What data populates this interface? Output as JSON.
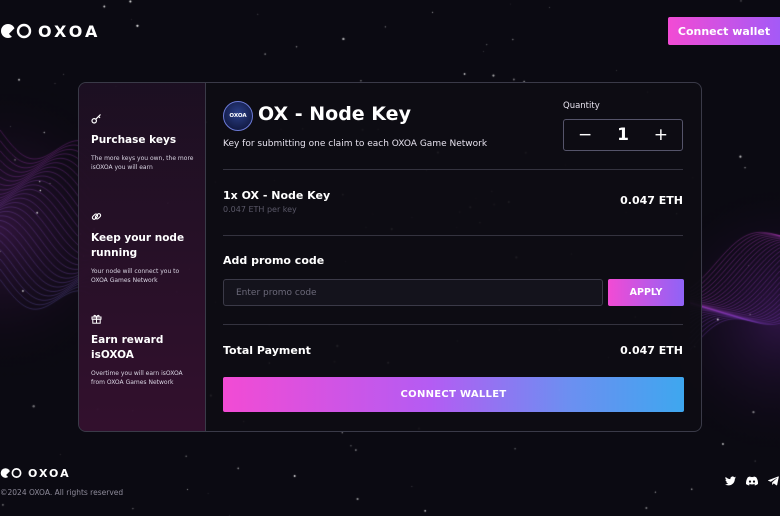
{
  "header": {
    "brand": "OXOA",
    "connect_label": "Connect wallet"
  },
  "features": [
    {
      "icon": "key-icon",
      "title": "Purchase keys",
      "text": "The more keys you own, the more isOXOA you will earn"
    },
    {
      "icon": "link-icon",
      "title": "Keep your node running",
      "text": "Your node will connect you to OXOA Games Network"
    },
    {
      "icon": "gift-icon",
      "title": "Earn reward isOXOA",
      "text": "Overtime you will earn isOXOA from OXOA Games Network"
    }
  ],
  "product": {
    "avatar_text": "OXOA",
    "title": "OX - Node Key",
    "subtitle": "Key for submitting one claim to each OXOA Game Network",
    "quantity_label": "Quantity",
    "quantity": "1",
    "minus": "−",
    "plus": "+"
  },
  "line_item": {
    "name": "1x OX - Node Key",
    "per_key": "0.047 ETH per key",
    "price": "0.047 ETH"
  },
  "promo": {
    "heading": "Add promo code",
    "placeholder": "Enter promo code",
    "apply_label": "APPLY"
  },
  "total": {
    "label": "Total Payment",
    "value": "0.047 ETH"
  },
  "cta_label": "CONNECT WALLET",
  "footer": {
    "brand": "OXOA",
    "copyright": "©2024 OXOA. All rights reserved"
  },
  "colors": {
    "accent_pink": "#f24bd4",
    "accent_purple": "#a45af7",
    "accent_blue": "#3ea7ef",
    "background": "#0b0a12"
  }
}
